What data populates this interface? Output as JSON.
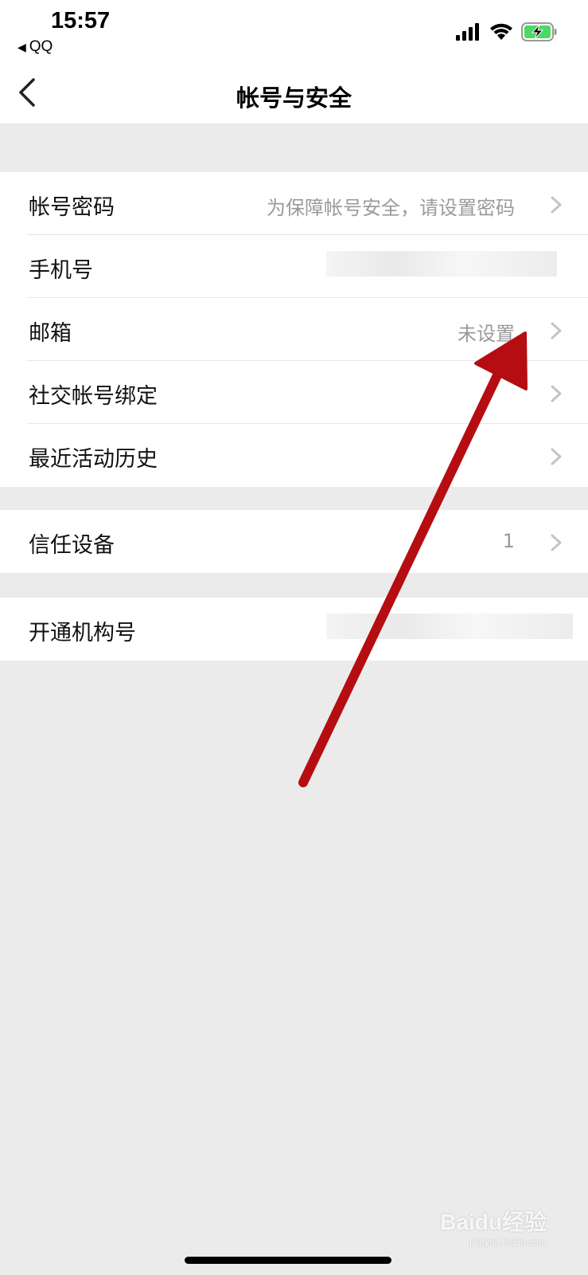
{
  "status_bar": {
    "time": "15:57",
    "back_app": "QQ",
    "back_app_arrow": "◀",
    "icons": [
      "signal-icon",
      "wifi-icon",
      "battery-charging-icon"
    ]
  },
  "nav": {
    "title": "帐号与安全",
    "back_icon": "chevron-left-icon"
  },
  "groups": [
    {
      "rows": [
        {
          "label": "帐号密码",
          "value": "为保障帐号安全，请设置密码"
        },
        {
          "label": "手机号",
          "value": ""
        },
        {
          "label": "邮箱",
          "value": "未设置"
        },
        {
          "label": "社交帐号绑定",
          "value": ""
        },
        {
          "label": "最近活动历史",
          "value": ""
        }
      ]
    },
    {
      "rows": [
        {
          "label": "信任设备",
          "value": "1"
        }
      ]
    },
    {
      "rows": [
        {
          "label": "开通机构号",
          "value": ""
        }
      ]
    }
  ],
  "annotation": {
    "color": "#b50d12",
    "icon": "red-arrow-annotation"
  },
  "watermark": {
    "text": "Baidu经验",
    "sub": "jingyan.baidu.com"
  },
  "colors": {
    "background": "#ebebeb",
    "surface": "#ffffff",
    "secondary_text": "#9a9a9a",
    "chevron": "#c4c4c4",
    "battery": "#4cd964"
  }
}
